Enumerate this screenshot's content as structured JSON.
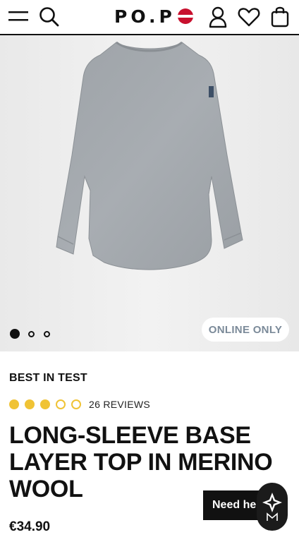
{
  "header": {
    "logo": "PO.P",
    "icons": [
      "menu-icon",
      "search-icon",
      "flag-icon",
      "account-icon",
      "heart-icon",
      "bag-icon"
    ],
    "flag_colors": {
      "red": "#c8102e",
      "white": "#ffffff"
    }
  },
  "gallery": {
    "product_image": "grey long-sleeve merino wool top",
    "slides_total": 3,
    "active_slide": 1,
    "badge": "ONLINE ONLY"
  },
  "product": {
    "label": "BEST IN TEST",
    "rating": 3,
    "rating_max": 5,
    "reviews": "26 REVIEWS",
    "title": "LONG-SLEEVE BASE LAYER TOP IN MERINO WOOL",
    "price": "€34.90"
  },
  "chat": {
    "label": "Need he"
  },
  "colors": {
    "text": "#111111",
    "star": "#f0c335",
    "badge_text": "#7b8a99",
    "image_bg": "#eeeeee",
    "garment": "#a3a8ad"
  }
}
